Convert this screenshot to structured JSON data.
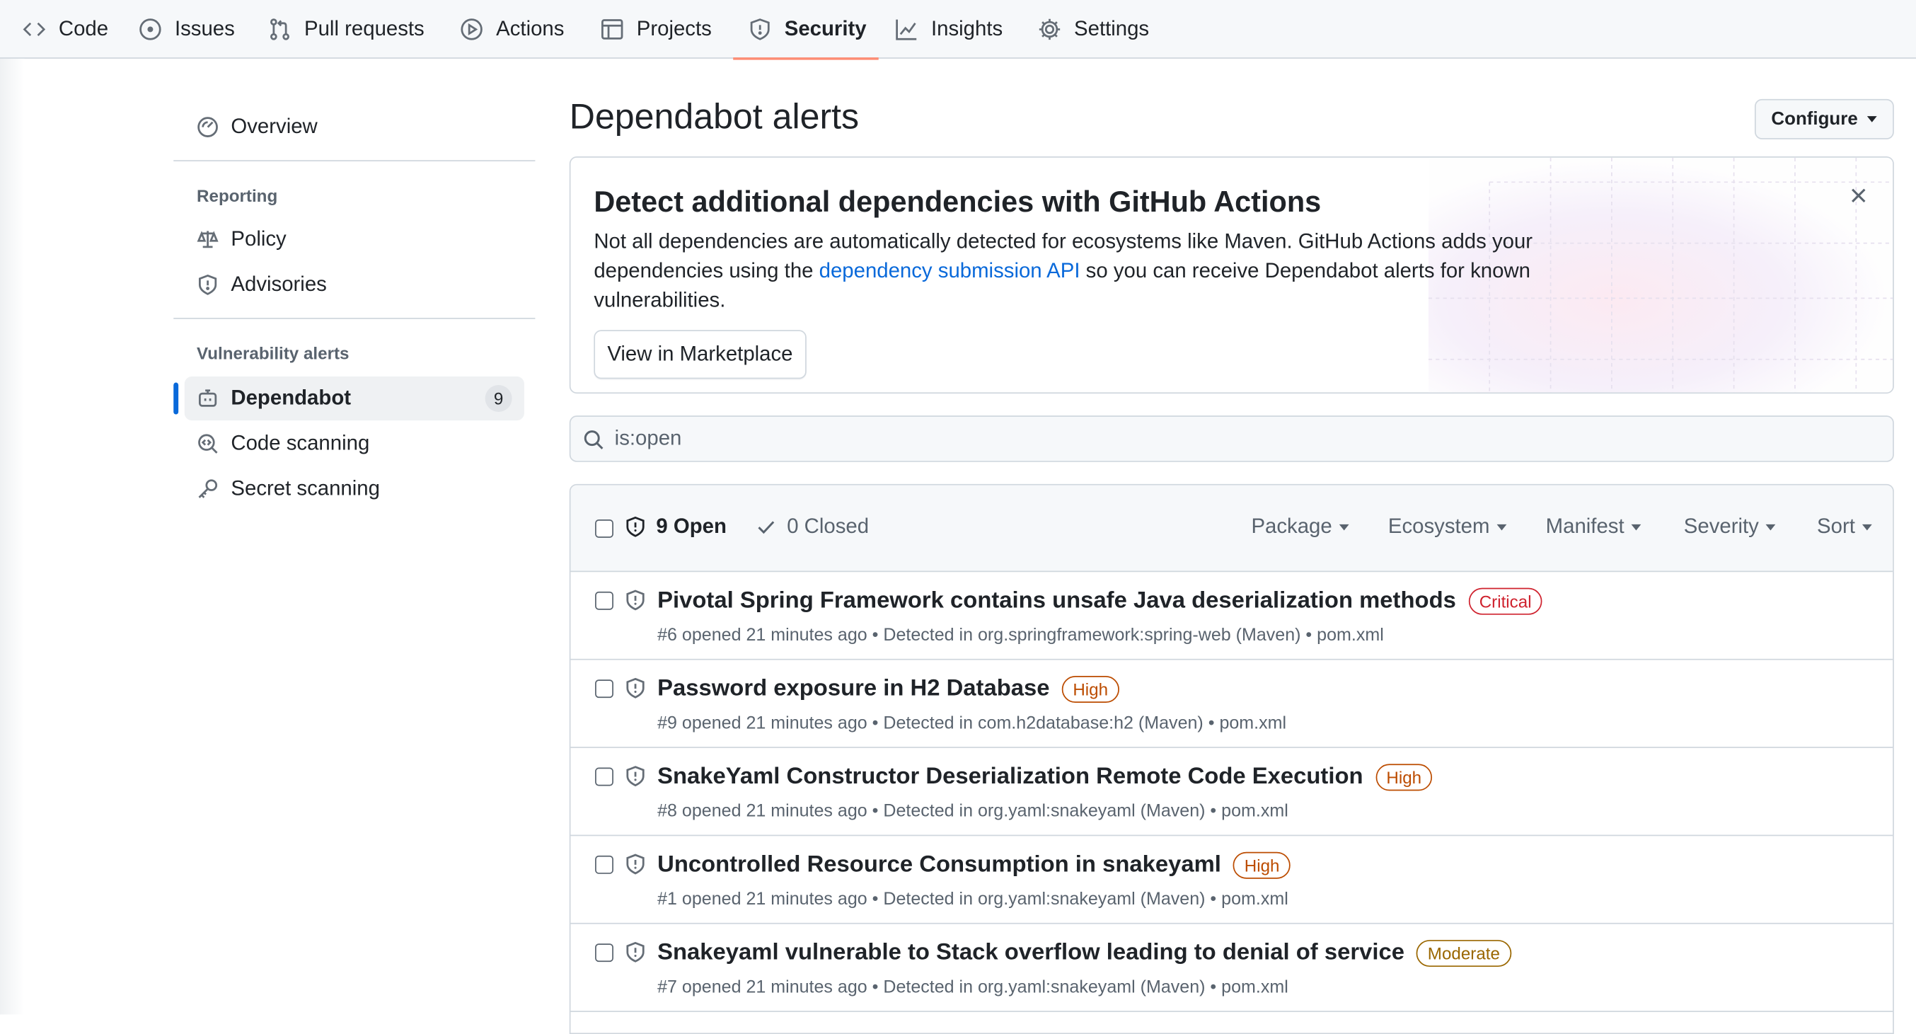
{
  "nav": {
    "tabs": [
      {
        "label": "Code",
        "icon": "code-icon"
      },
      {
        "label": "Issues",
        "icon": "issue-icon"
      },
      {
        "label": "Pull requests",
        "icon": "pull-request-icon"
      },
      {
        "label": "Actions",
        "icon": "play-icon"
      },
      {
        "label": "Projects",
        "icon": "table-icon"
      },
      {
        "label": "Security",
        "icon": "shield-icon",
        "active": true
      },
      {
        "label": "Insights",
        "icon": "graph-icon"
      },
      {
        "label": "Settings",
        "icon": "gear-icon"
      }
    ]
  },
  "sidebar": {
    "overview": "Overview",
    "reporting_heading": "Reporting",
    "policy": "Policy",
    "advisories": "Advisories",
    "vuln_heading": "Vulnerability alerts",
    "dependabot": "Dependabot",
    "dependabot_count": "9",
    "code_scanning": "Code scanning",
    "secret_scanning": "Secret scanning"
  },
  "main": {
    "title": "Dependabot alerts",
    "configure": "Configure"
  },
  "banner": {
    "title": "Detect additional dependencies with GitHub Actions",
    "text_before": "Not all dependencies are automatically detected for ecosystems like Maven. GitHub Actions adds your dependencies using the ",
    "link": "dependency submission API",
    "text_after": " so you can receive Dependabot alerts for known vulnerabilities.",
    "button": "View in Marketplace"
  },
  "search": {
    "value": "is:open"
  },
  "alerts_header": {
    "open": "9 Open",
    "closed": "0 Closed",
    "filters": [
      "Package",
      "Ecosystem",
      "Manifest",
      "Severity",
      "Sort"
    ]
  },
  "alerts": [
    {
      "title": "Pivotal Spring Framework contains unsafe Java deserialization methods",
      "severity": "Critical",
      "meta": "#6 opened 21 minutes ago • Detected in org.springframework:spring-web (Maven) • pom.xml"
    },
    {
      "title": "Password exposure in H2 Database",
      "severity": "High",
      "meta": "#9 opened 21 minutes ago • Detected in com.h2database:h2 (Maven) • pom.xml"
    },
    {
      "title": "SnakeYaml Constructor Deserialization Remote Code Execution",
      "severity": "High",
      "meta": "#8 opened 21 minutes ago • Detected in org.yaml:snakeyaml (Maven) • pom.xml"
    },
    {
      "title": "Uncontrolled Resource Consumption in snakeyaml",
      "severity": "High",
      "meta": "#1 opened 21 minutes ago • Detected in org.yaml:snakeyaml (Maven) • pom.xml"
    },
    {
      "title": "Snakeyaml vulnerable to Stack overflow leading to denial of service",
      "severity": "Moderate",
      "meta": "#7 opened 21 minutes ago • Detected in org.yaml:snakeyaml (Maven) • pom.xml"
    }
  ],
  "colors": {
    "accent": "#0969da",
    "tab_underline": "#fd8c73",
    "critical": "#cf222e",
    "high": "#bc4c00",
    "moderate": "#9a6700"
  }
}
